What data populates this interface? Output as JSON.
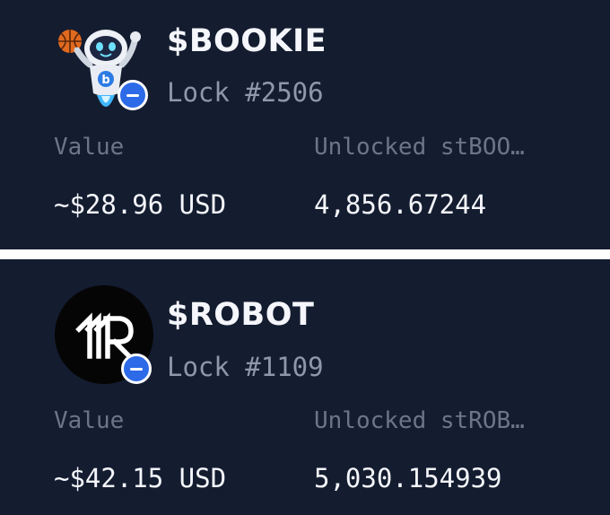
{
  "locks": [
    {
      "token": "$BOOKIE",
      "lock_label": "Lock #2506",
      "value_label": "Value",
      "unlocked_label": "Unlocked stBOO…",
      "value": "~$28.96 USD",
      "unlocked": "4,856.67244",
      "logo_icon": "bookie-robot-mascot-icon"
    },
    {
      "token": "$ROBOT",
      "lock_label": "Lock #1109",
      "value_label": "Value",
      "unlocked_label": "Unlocked stROB…",
      "value": "~$42.15 USD",
      "unlocked": "5,030.154939",
      "logo_icon": "robot-r-logo-icon"
    }
  ],
  "colors": {
    "card_bg": "#141c30",
    "text_primary": "#f4f6fb",
    "text_muted": "#6c7589",
    "lock_text": "#8e97ab",
    "badge_blue": "#2c6ae8",
    "separator": "#ffffff"
  }
}
